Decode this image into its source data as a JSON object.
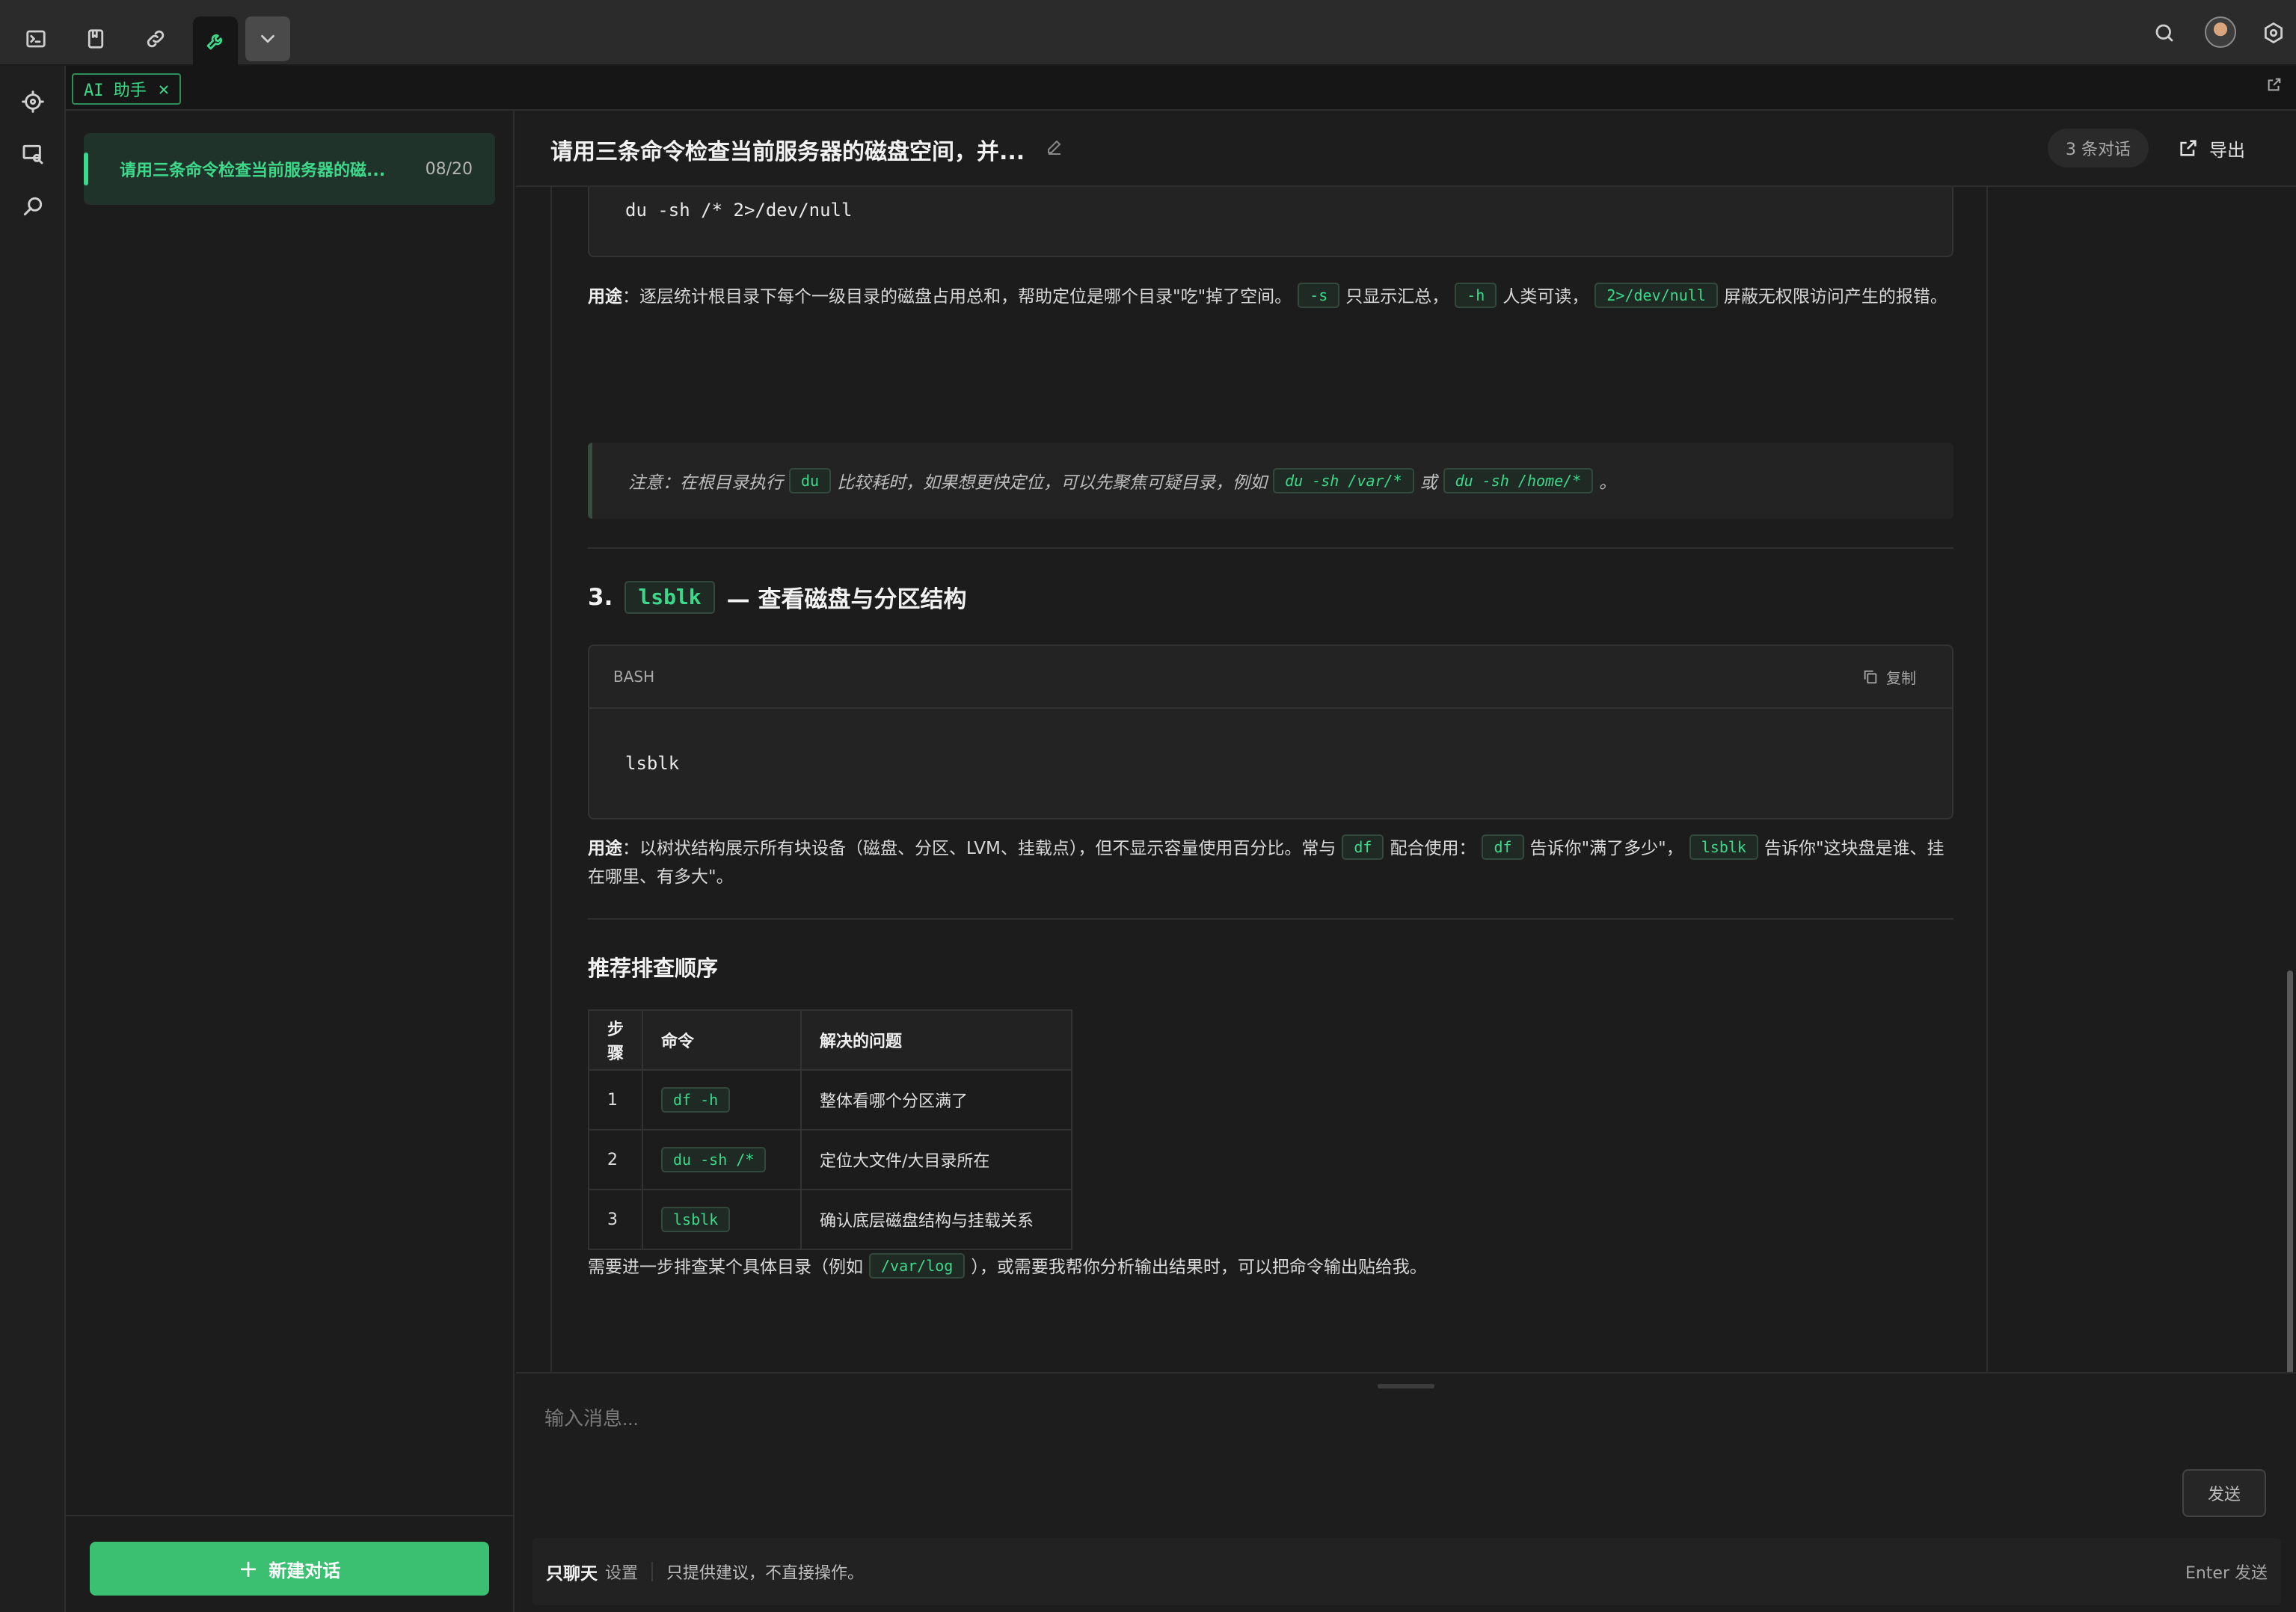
{
  "toolbar": {
    "items": [
      {
        "icon": "terminal-icon"
      },
      {
        "icon": "bookmark-icon"
      },
      {
        "icon": "link-icon"
      },
      {
        "icon": "wrench-icon"
      },
      {
        "icon": "chevron-down-icon"
      }
    ],
    "active_index": 3,
    "right_icons": [
      "search-icon",
      "avatar",
      "settings-icon"
    ]
  },
  "rail": {
    "icons": [
      "crosshair-icon",
      "screen-search-icon",
      "search-icon"
    ]
  },
  "tab": {
    "label": "AI 助手",
    "close": "✕"
  },
  "sidebar": {
    "conversations": [
      {
        "title": "请用三条命令检查当前服务器的磁...",
        "date": "08/20",
        "active": true
      }
    ],
    "new_button": {
      "icon": "+",
      "label": "新建对话"
    }
  },
  "header": {
    "title": "请用三条命令检查当前服务器的磁盘空间，并...",
    "count": "3 条对话",
    "export": "导出"
  },
  "content": {
    "code_du": "du -sh /* 2>/dev/null",
    "usage_du": {
      "label": "用途",
      "p1": "：逐层统计根目录下每个一级目录的磁盘占用总和，帮助定位是哪个目录\"吃\"掉了空间。",
      "c1": "-s",
      "p2": "只显示汇总，",
      "c2": "-h",
      "p3": "人类可读，",
      "c3": "2>/dev/null",
      "p4": "屏蔽无权限访问产生的报错。"
    },
    "note": {
      "p1": "注意：在根目录执行",
      "c1": "du",
      "p2": "比较耗时，如果想更快定位，可以先聚焦可疑目录，例如",
      "c2": "du -sh /var/*",
      "p3": "或",
      "c3": "du -sh /home/*",
      "p4": "。"
    },
    "section3": {
      "num": "3.",
      "code": "lsblk",
      "rest": "— 查看磁盘与分区结构"
    },
    "code_lsblk": {
      "lang": "BASH",
      "copy": "复制",
      "code": "lsblk"
    },
    "usage_lsblk": {
      "label": "用途",
      "p1": "：以树状结构展示所有块设备（磁盘、分区、LVM、挂载点），但不显示容量使用百分比。常与",
      "c1": "df",
      "p2": "配合使用：",
      "c2": "df",
      "p3": "告诉你\"满了多少\"，",
      "c3": "lsblk",
      "p4": "告诉你\"这块盘是谁、挂在哪里、有多大\"。"
    },
    "order_title": "推荐排查顺序",
    "table": {
      "headers": [
        "步骤",
        "命令",
        "解决的问题"
      ],
      "rows": [
        [
          "1",
          "df -h",
          "整体看哪个分区满了"
        ],
        [
          "2",
          "du -sh /*",
          "定位大文件/大目录所在"
        ],
        [
          "3",
          "lsblk",
          "确认底层磁盘结构与挂载关系"
        ]
      ]
    },
    "closing": {
      "p1": "需要进一步排查某个具体目录（例如",
      "c1": "/var/log",
      "p2": "），或需要我帮你分析输出结果时，可以把命令输出贴给我。"
    }
  },
  "input": {
    "placeholder": "输入消息...",
    "send": "发送"
  },
  "status": {
    "mode": "只聊天",
    "settings": "设置",
    "desc": "只提供建议，不直接操作。",
    "hint": "Enter 发送"
  },
  "colors": {
    "accent": "#3dd98a",
    "button_green": "#3bbf71",
    "background": "#1c1c1c"
  }
}
